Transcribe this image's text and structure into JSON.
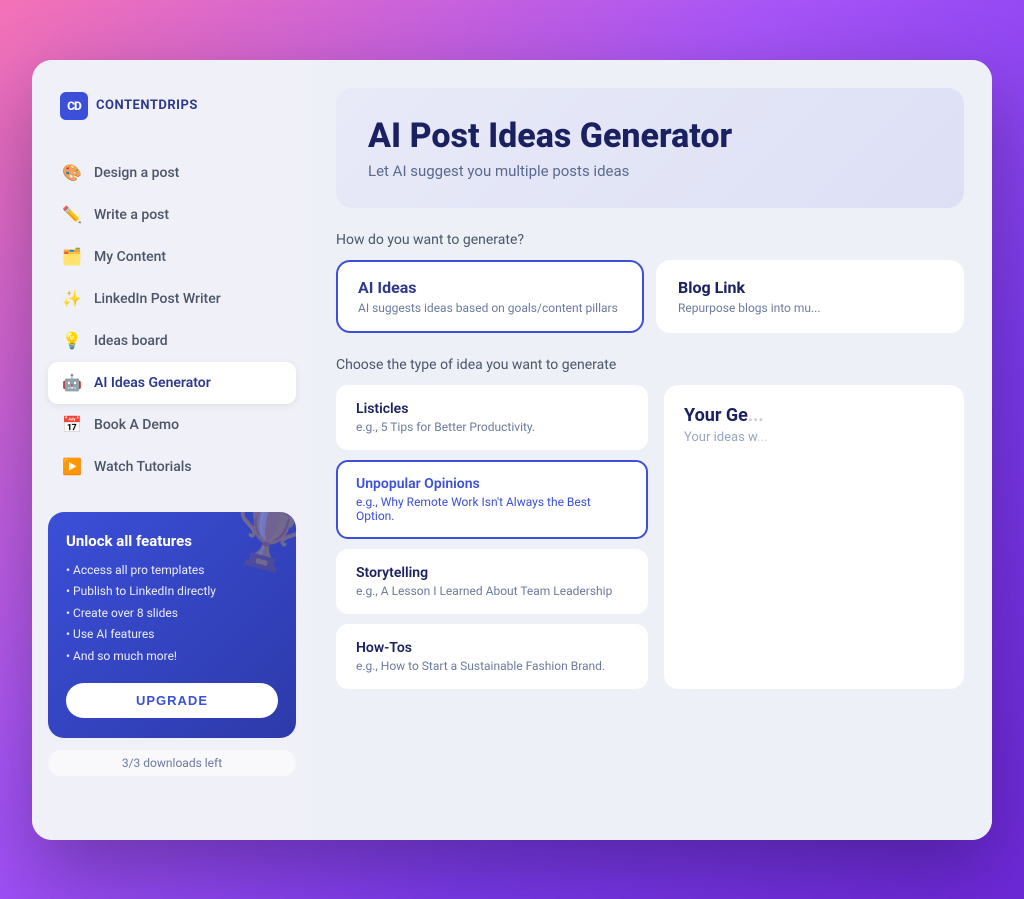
{
  "app": {
    "logo_text": "CONTENTDRIPS",
    "logo_abbr": "CD"
  },
  "sidebar": {
    "nav_items": [
      {
        "id": "design-post",
        "label": "Design a post",
        "icon": "🎨",
        "active": false
      },
      {
        "id": "write-post",
        "label": "Write a post",
        "icon": "✏️",
        "active": false
      },
      {
        "id": "my-content",
        "label": "My Content",
        "icon": "🗂️",
        "active": false
      },
      {
        "id": "linkedin-writer",
        "label": "LinkedIn Post Writer",
        "icon": "✨",
        "active": false
      },
      {
        "id": "ideas-board",
        "label": "Ideas board",
        "icon": "💡",
        "active": false
      },
      {
        "id": "ai-ideas-generator",
        "label": "AI Ideas Generator",
        "icon": "🤖",
        "active": true
      },
      {
        "id": "book-demo",
        "label": "Book A Demo",
        "icon": "📅",
        "active": false
      },
      {
        "id": "watch-tutorials",
        "label": "Watch Tutorials",
        "icon": "▶️",
        "active": false
      }
    ],
    "upgrade_card": {
      "title": "Unlock all features",
      "features": [
        "Access all pro templates",
        "Publish to LinkedIn directly",
        "Create over 8 slides",
        "Use AI features",
        "And so much more!"
      ],
      "button_label": "UPGRADE",
      "decoration": "🏆"
    },
    "downloads_badge": "3/3 downloads left"
  },
  "main": {
    "header": {
      "title": "AI Post Ideas Generator",
      "subtitle": "Let AI suggest you multiple posts ideas"
    },
    "generate_section": {
      "label": "How do you want to generate?",
      "types": [
        {
          "id": "ai-ideas",
          "title": "AI Ideas",
          "description": "AI suggests ideas based on goals/content pillars",
          "active": true
        },
        {
          "id": "blog-link",
          "title": "Blog Link",
          "description": "Repurpose blogs into mu...",
          "active": false
        }
      ]
    },
    "idea_types": {
      "label": "Choose the type of idea you want to generate",
      "items": [
        {
          "id": "listicles",
          "title": "Listicles",
          "example": "e.g., 5 Tips for Better Productivity.",
          "selected": false
        },
        {
          "id": "unpopular-opinions",
          "title": "Unpopular Opinions",
          "example": "e.g., Why Remote Work Isn't Always the Best Option.",
          "selected": true
        },
        {
          "id": "storytelling",
          "title": "Storytelling",
          "example": "e.g., A Lesson I Learned About Team Leadership",
          "selected": false
        },
        {
          "id": "how-tos",
          "title": "How-Tos",
          "example": "e.g., How to Start a Sustainable Fashion Brand.",
          "selected": false
        }
      ]
    },
    "generated_panel": {
      "title": "Your Ge...",
      "subtitle": "Your ideas w..."
    }
  }
}
